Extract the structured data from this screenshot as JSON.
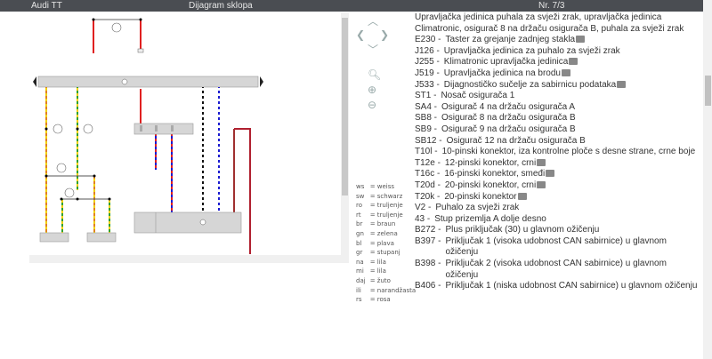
{
  "header": {
    "model": "Audi TT",
    "title": "Dijagram sklopa",
    "number": "Nr. 7/3"
  },
  "description": "Upravljačka jedinica puhala za svježi zrak, upravljačka jedinica Climatronic, osigurač 8 na držaču osigurača B, puhala za svježi zrak",
  "components": [
    {
      "code": "E230 -",
      "text": "Taster za grejanje zadnjeg stakla",
      "camera": true
    },
    {
      "code": "J126 -",
      "text": "Upravljačka jedinica za puhalo za svježi zrak",
      "camera": false
    },
    {
      "code": "J255 -",
      "text": "Klimatronic upravljačka jedinica",
      "camera": true
    },
    {
      "code": "J519 -",
      "text": "Upravljačka jedinica na brodu",
      "camera": true
    },
    {
      "code": "J533 -",
      "text": "Dijagnostičko sučelje za sabirnicu podataka",
      "camera": true
    },
    {
      "code": "ST1 -",
      "text": "Nosač osigurača 1",
      "camera": false
    },
    {
      "code": "SA4 -",
      "text": "Osigurač 4 na držaču osigurača A",
      "camera": false
    },
    {
      "code": "SB8 -",
      "text": "Osigurač 8 na držaču osigurača B",
      "camera": false
    },
    {
      "code": "SB9 -",
      "text": "Osigurač 9 na držaču osigurača B",
      "camera": false
    },
    {
      "code": "SB12 -",
      "text": "Osigurač 12 na držaču osigurača B",
      "camera": false
    },
    {
      "code": "T10l -",
      "text": "10-pinski konektor, iza kontrolne ploče s desne strane, crne boje",
      "camera": false
    },
    {
      "code": "T12e -",
      "text": "12-pinski konektor, crni",
      "camera": true
    },
    {
      "code": "T16c -",
      "text": "16-pinski konektor, smeđi",
      "camera": true
    },
    {
      "code": "T20d -",
      "text": "20-pinski konektor, crni",
      "camera": true
    },
    {
      "code": "T20k -",
      "text": "20-pinski konektor",
      "camera": true
    },
    {
      "code": "V2 -",
      "text": "Puhalo za svježi zrak",
      "camera": false
    },
    {
      "code": "43 -",
      "text": "Stup prizemlja A dolje desno",
      "camera": false
    },
    {
      "code": "B272 -",
      "text": "Plus priključak (30) u glavnom ožičenju",
      "camera": false
    },
    {
      "code": "B397 -",
      "text": "Priključak 1 (visoka udobnost CAN sabirnice) u glavnom ožičenju",
      "camera": false
    },
    {
      "code": "B398 -",
      "text": "Priključak 2 (visoka udobnost CAN sabirnice) u glavnom ožičenju",
      "camera": false
    },
    {
      "code": "B406 -",
      "text": "Priključak 1 (niska udobnost CAN sabirnice) u glavnom ožičenju",
      "camera": false
    }
  ],
  "legend": [
    [
      "ws",
      "= weiss"
    ],
    [
      "sw",
      "= schwarz"
    ],
    [
      "ro",
      "= trulјenje"
    ],
    [
      "rt",
      "= trulјenje"
    ],
    [
      "br",
      "= braun"
    ],
    [
      "gn",
      "= zelena"
    ],
    [
      "bl",
      "= plava"
    ],
    [
      "gr",
      "= stupanj"
    ],
    [
      "na",
      "= lila"
    ],
    [
      "mi",
      "= lila"
    ],
    [
      "daj",
      "= žuto"
    ],
    [
      "ili",
      "= narandžasta"
    ],
    [
      "rs",
      "= rosa"
    ]
  ],
  "nav_icons": [
    "arrow-up-icon",
    "arrow-left-icon",
    "arrow-right-icon",
    "arrow-down-icon",
    "zoom-icon",
    "zoom-in-icon",
    "zoom-out-icon"
  ],
  "colors": {
    "header": "#4a4d52",
    "wire_red": "#e02020",
    "wire_blue": "#1a1ad0",
    "wire_orange": "#e08020",
    "wire_green": "#30a030",
    "wire_yellow": "#f0d000"
  }
}
